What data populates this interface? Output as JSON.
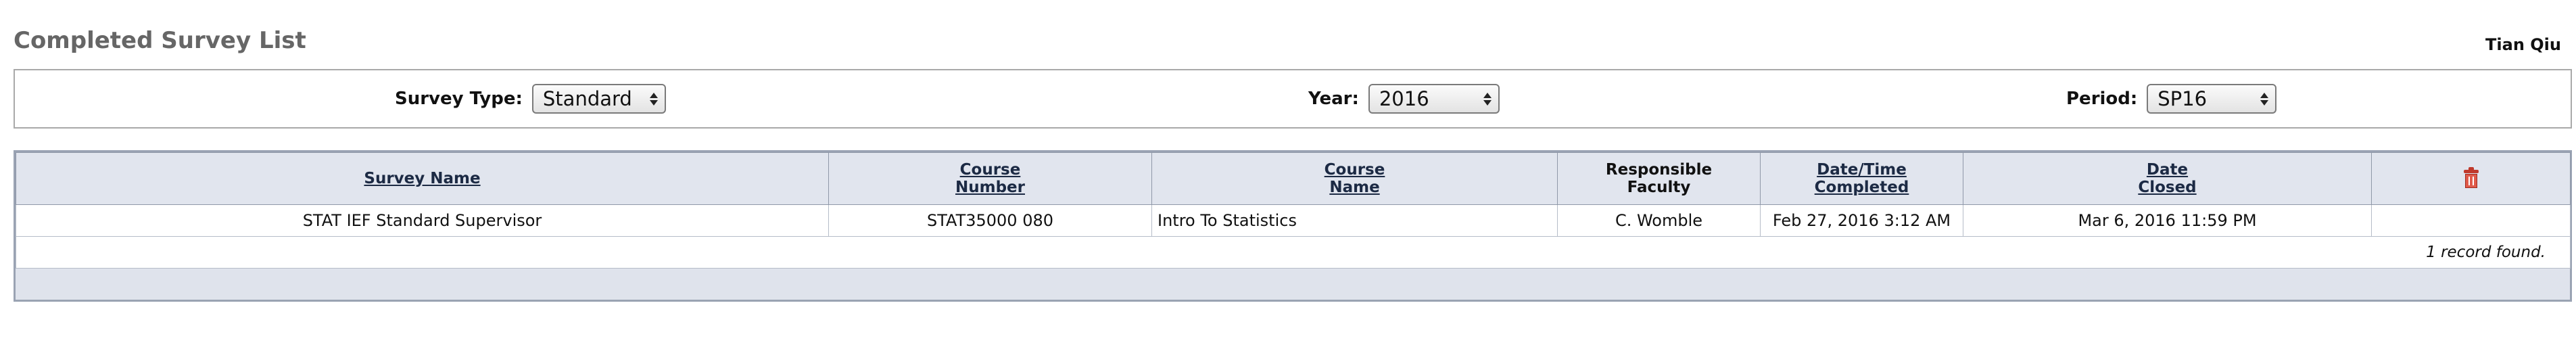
{
  "header": {
    "title": "Completed Survey List",
    "user": "Tian Qiu"
  },
  "filters": {
    "survey_type": {
      "label": "Survey Type:",
      "value": "Standard"
    },
    "year": {
      "label": "Year:",
      "value": "2016"
    },
    "period": {
      "label": "Period:",
      "value": "SP16"
    }
  },
  "table": {
    "columns": [
      {
        "line1": "Survey Name",
        "line2": ""
      },
      {
        "line1": "Course",
        "line2": "Number"
      },
      {
        "line1": "Course",
        "line2": "Name"
      },
      {
        "line1": "Responsible",
        "line2": "Faculty"
      },
      {
        "line1": "Date/Time",
        "line2": "Completed"
      },
      {
        "line1": "Date",
        "line2": "Closed"
      }
    ],
    "rows": [
      {
        "survey_name": "STAT IEF Standard Supervisor",
        "course_number": "STAT35000 080",
        "course_name": "Intro To Statistics",
        "faculty": "C. Womble",
        "completed": "Feb 27, 2016 3:12 AM",
        "closed": "Mar 6, 2016 11:59 PM"
      }
    ],
    "record_count_text": "1 record found."
  },
  "icons": {
    "delete_column": "trash-icon"
  },
  "colors": {
    "header_bg": "#e1e5ee",
    "table_border": "#9aa3b3",
    "trash": "#c0392b"
  }
}
